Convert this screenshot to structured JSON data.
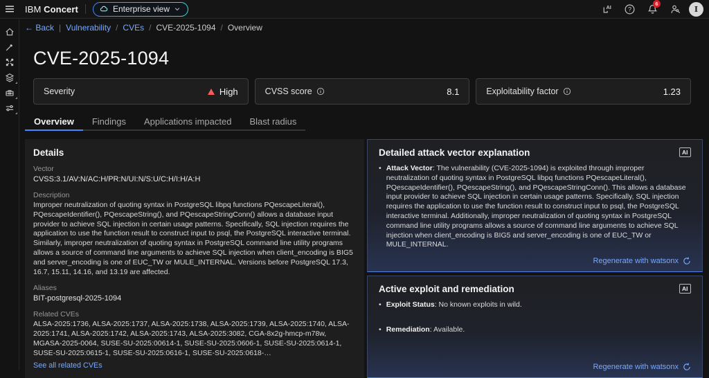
{
  "header": {
    "brand_ibm": "IBM",
    "brand_product": "Concert",
    "view_switcher_label": "Enterprise view",
    "notification_count": "6",
    "avatar_initial": "I"
  },
  "breadcrumb": {
    "back_label": "← Back",
    "items": [
      {
        "label": "Vulnerability",
        "link": true
      },
      {
        "label": "CVEs",
        "link": true
      },
      {
        "label": "CVE-2025-1094",
        "link": false
      },
      {
        "label": "Overview",
        "link": false
      }
    ],
    "separator": "/"
  },
  "page": {
    "title": "CVE-2025-1094"
  },
  "metrics": [
    {
      "label": "Severity",
      "value": "High",
      "indicator": "warning-triangle"
    },
    {
      "label": "CVSS score",
      "value": "8.1",
      "has_info_icon": true
    },
    {
      "label": "Exploitability factor",
      "value": "1.23",
      "has_info_icon": true
    }
  ],
  "tabs": [
    {
      "label": "Overview",
      "active": true
    },
    {
      "label": "Findings",
      "active": false
    },
    {
      "label": "Applications impacted",
      "active": false
    },
    {
      "label": "Blast radius",
      "active": false
    }
  ],
  "details": {
    "title": "Details",
    "vector_label": "Vector",
    "vector": "CVSS:3.1/AV:N/AC:H/PR:N/UI:N/S:U/C:H/I:H/A:H",
    "description_label": "Description",
    "description": "Improper neutralization of quoting syntax in PostgreSQL libpq functions PQescapeLiteral(), PQescapeIdentifier(), PQescapeString(), and PQescapeStringConn() allows a database input provider to achieve SQL injection in certain usage patterns. Specifically, SQL injection requires the application to use the function result to construct input to psql, the PostgreSQL interactive terminal. Similarly, improper neutralization of quoting syntax in PostgreSQL command line utility programs allows a source of command line arguments to achieve SQL injection when client_encoding is BIG5 and server_encoding is one of EUC_TW or MULE_INTERNAL. Versions before PostgreSQL 17.3, 16.7, 15.11, 14.16, and 13.19 are affected.",
    "aliases_label": "Aliases",
    "aliases": "BIT-postgresql-2025-1094",
    "related_label": "Related CVEs",
    "related": "ALSA-2025:1736, ALSA-2025:1737, ALSA-2025:1738, ALSA-2025:1739, ALSA-2025:1740, ALSA-2025:1741, ALSA-2025:1742, ALSA-2025:1743, ALSA-2025:3082, CGA-8x2g-hmcp-m78w, MGASA-2025-0064, SUSE-SU-2025:00614-1, SUSE-SU-2025:0606-1, SUSE-SU-2025:0614-1, SUSE-SU-2025:0615-1, SUSE-SU-2025:0616-1, SUSE-SU-2025:0618-…",
    "see_all_link": "See all related CVEs"
  },
  "ai_panels": [
    {
      "title": "Detailed attack vector explanation",
      "badge": "AI",
      "bullets": [
        {
          "term": "Attack Vector",
          "text": "The vulnerability (CVE-2025-1094) is exploited through improper neutralization of quoting syntax in PostgreSQL libpq functions PQescapeLiteral(), PQescapeIdentifier(), PQescapeString(), and PQescapeStringConn(). This allows a database input provider to achieve SQL injection in certain usage patterns. Specifically, SQL injection requires the application to use the function result to construct input to psql, the PostgreSQL interactive terminal. Additionally, improper neutralization of quoting syntax in PostgreSQL command line utility programs allows a source of command line arguments to achieve SQL injection when client_encoding is BIG5 and server_encoding is one of EUC_TW or MULE_INTERNAL."
        }
      ],
      "action": "Regenerate with watsonx"
    },
    {
      "title": "Active exploit and remediation",
      "badge": "AI",
      "bullets": [
        {
          "term": "Exploit Status",
          "text": "No known exploits in wild."
        },
        {
          "term": "Remediation",
          "text": "Available."
        }
      ],
      "action": "Regenerate with watsonx"
    }
  ],
  "sidebar_icons": [
    "home",
    "tools",
    "connections",
    "layers",
    "toolbox",
    "settings-adjust"
  ],
  "icons": {
    "ai_insights": "AI with arrow glyph",
    "help": "? in circle",
    "notifications": "bell",
    "user_settings": "person with wrench",
    "regenerate": "circular restart arrow",
    "info": "i in circle",
    "warning": "filled triangle"
  },
  "colors": {
    "accent_blue": "#4589ff",
    "link_blue": "#78a9ff",
    "severity_high_red": "#fa5c5c",
    "notification_badge_red": "#da1e28",
    "panel_bg": "#1e1e1e",
    "page_bg": "#131313"
  }
}
